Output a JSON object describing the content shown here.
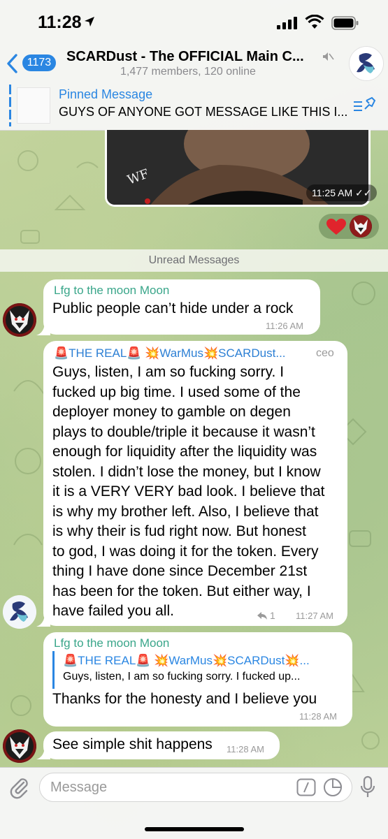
{
  "status_bar": {
    "time": "11:28"
  },
  "header": {
    "back_badge": "1173",
    "title": "SCARDust - The OFFICIAL Main C...",
    "subtitle": "1,477 members, 120 online"
  },
  "pinned": {
    "title": "Pinned Message",
    "text": "GUYS OF ANYONE GOT MESSAGE LIKE THIS I..."
  },
  "image_message": {
    "time": "11:25 AM"
  },
  "divider": {
    "label": "Unread Messages"
  },
  "messages": [
    {
      "sender": "Lfg to the moon Moon",
      "text": "Public people can’t hide under a rock",
      "time": "11:26 AM"
    },
    {
      "sender": "🚨THE REAL🚨 💥WarMus💥SCARDust...",
      "role": "ceo",
      "lines": [
        "Guys, listen, I am so fucking sorry. I",
        "fucked up big time. I used some of the",
        "deployer money to gamble on degen",
        "plays to double/triple it because it wasn’t",
        "enough for liquidity after the liquidity was",
        "stolen. I didn’t lose the money, but I know",
        "it is a VERY VERY bad look. I believe that",
        "is why my brother left. Also, I believe that",
        "is why their is fud right now. But honest",
        "to god, I was doing it for the token. Every",
        "thing I have done since December 21st",
        "has been for the token. But either way, I",
        "have failed you all."
      ],
      "replies": "1",
      "time": "11:27 AM"
    },
    {
      "sender": "Lfg to the moon Moon",
      "reply_to_name": "🚨THE REAL🚨 💥WarMus💥SCARDust💥...",
      "reply_to_text": "Guys, listen, I am so fucking sorry. I fucked up...",
      "text": "Thanks for the honesty and I believe you",
      "time": "11:28 AM"
    },
    {
      "text": "See simple shit happens",
      "time": "11:28 AM"
    }
  ],
  "composer": {
    "placeholder": "Message"
  },
  "colors": {
    "accent": "#2a86e2",
    "sender_green": "#3aa68a",
    "heart": "#e0242c"
  },
  "icons": [
    "back-chevron-icon",
    "mute-icon",
    "pin-list-icon",
    "heart-icon",
    "reply-arrow-icon",
    "attach-icon",
    "command-icon",
    "sticker-icon",
    "mic-icon"
  ]
}
